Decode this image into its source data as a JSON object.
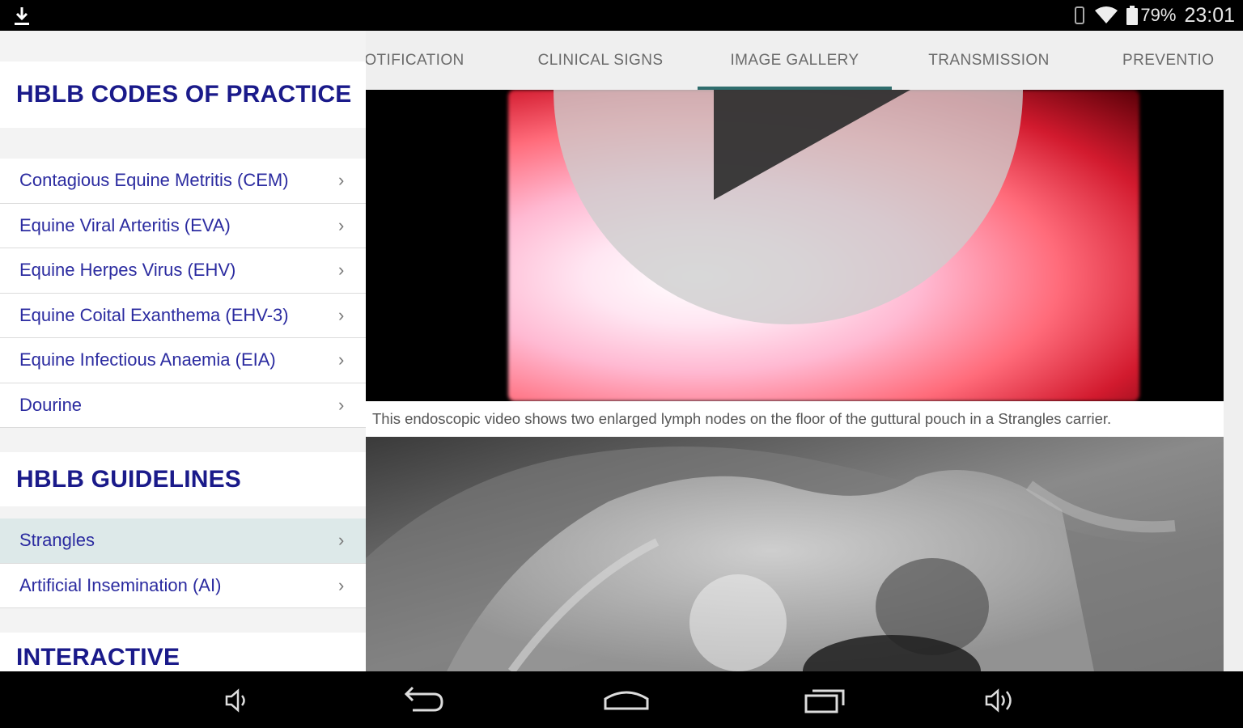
{
  "status_bar": {
    "battery_percent": "79%",
    "time": "23:01",
    "icons": [
      "download-icon",
      "vibrate-icon",
      "wifi-icon",
      "battery-icon"
    ]
  },
  "sidebar": {
    "sections": [
      {
        "title": "HBLB CODES OF PRACTICE",
        "items": [
          {
            "label": "Contagious Equine Metritis (CEM)"
          },
          {
            "label": "Equine Viral Arteritis (EVA)"
          },
          {
            "label": "Equine Herpes Virus (EHV)"
          },
          {
            "label": "Equine Coital Exanthema (EHV-3)"
          },
          {
            "label": "Equine Infectious Anaemia (EIA)"
          },
          {
            "label": "Dourine"
          }
        ]
      },
      {
        "title": "HBLB GUIDELINES",
        "items": [
          {
            "label": "Strangles",
            "selected": true
          },
          {
            "label": "Artificial Insemination (AI)"
          }
        ]
      },
      {
        "title": "INTERACTIVE",
        "items": []
      }
    ]
  },
  "tabs": [
    {
      "label": "OTIFICATION"
    },
    {
      "label": "CLINICAL SIGNS"
    },
    {
      "label": "IMAGE GALLERY",
      "active": true
    },
    {
      "label": "TRANSMISSION"
    },
    {
      "label": "PREVENTIO"
    }
  ],
  "gallery": {
    "caption": "This endoscopic video shows two enlarged lymph nodes on the floor of the guttural pouch in a Strangles carrier."
  },
  "colors": {
    "header_text": "#1a1a8a",
    "link_text": "#2b2ba0",
    "selected_row": "#dde9e9",
    "tab_indicator": "#2f6d6d"
  },
  "navbar": {
    "icons": [
      "volume-down-icon",
      "back-icon",
      "home-icon",
      "recents-icon",
      "volume-up-icon"
    ]
  }
}
